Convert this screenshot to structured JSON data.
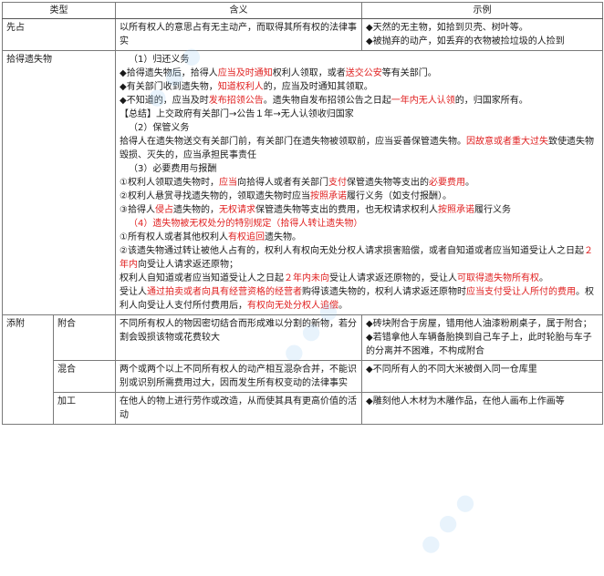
{
  "header": {
    "type": "类型",
    "meaning": "含义",
    "example": "示例"
  },
  "rows": {
    "xianzhan": {
      "type": "先占",
      "meaning": "以所有权人的意思占有无主动产，而取得其所有权的法律事实",
      "examples": [
        "◆天然的无主物，如拾到贝壳、树叶等。",
        "◆被抛弃的动产，如丢弃的衣物被捡垃圾的人捡到"
      ]
    },
    "shide": {
      "type": "拾得遗失物",
      "s1_head": "（1）归还义务",
      "l1_a": "◆拾得遗失物后，拾得人",
      "l1_b": "应当及时通知",
      "l1_c": "权利人领取，或者",
      "l1_d": "送交公安",
      "l1_e": "等有关部门。",
      "l2_a": "◆有关部门收到遗失物，",
      "l2_b": "知道权利人",
      "l2_c": "的，应当及时通知其领取。",
      "l3_a": "◆不知道的，应当及时",
      "l3_b": "发布招领公告",
      "l3_c": "。遗失物自发布招领公告之日起",
      "l3_d": "一年内无人认领",
      "l3_e": "的，归国家所有。",
      "summary": "【总结】上交政府有关部门→公告１年→无人认领收归国家",
      "s2_head": "（2）保管义务",
      "s2_a": "拾得人在遗失物送交有关部门前，有关部门在遗失物被领取前，应当妥善保管遗失物。",
      "s2_b": "因故意或者重大过失",
      "s2_c": "致使遗失物毁损、灭失的，应当承担民事责任",
      "s3_head": "（3）必要费用与报酬",
      "e1_a": "①权利人领取遗失物时，",
      "e1_b": "应当",
      "e1_c": "向拾得人或者有关部门",
      "e1_d": "支付",
      "e1_e": "保管遗失物等支出的",
      "e1_f": "必要费用",
      "e1_g": "。",
      "e2_a": "②权利人悬赏寻找遗失物的，领取遗失物时应当",
      "e2_b": "按照承诺",
      "e2_c": "履行义务（如支付报酬）。",
      "e3_a": "③拾得人",
      "e3_b": "侵占",
      "e3_c": "遗失物的，",
      "e3_d": "无权请求",
      "e3_e": "保管遗失物等支出的费用，也无权请求权利人",
      "e3_f": "按照承诺",
      "e3_g": "履行义务",
      "s4_head": "（4）遗失物被无权处分的特别规定（拾得人转让遗失物）",
      "f1_a": "①所有权人或者其他权利人",
      "f1_b": "有权追回",
      "f1_c": "遗失物。",
      "f2_a": "②该遗失物通过转让被他人占有的，权利人有权向无处分权人请求损害赔偿，或者自知道或者应当知道受让人之日起",
      "f2_b": "２年内",
      "f2_c": "向受让人请求返还原物；",
      "f3_a": "权利人自知道或者应当知道受让人之日起",
      "f3_b": "２年内未向",
      "f3_c": "受让人请求返还原物的，受让人",
      "f3_d": "可取得遗失物所有权",
      "f3_e": "。",
      "f4_a": "受让人",
      "f4_b": "通过拍卖或者向具有经营资格的经营者",
      "f4_c": "购得该遗失物的，权利人请求返还原物时",
      "f4_d": "应当支付受让人所付的费用",
      "f4_e": "。权利人向受让人支付所付费用后，",
      "f4_f": "有权向无处分权人追偿",
      "f4_g": "。"
    },
    "tianfu": {
      "type": "添附",
      "fuhe": {
        "sub": "附合",
        "meaning": "不同所有权人的物因密切结合而形成难以分割的新物，若分割会毁损该物或花费较大",
        "examples": [
          "◆砖块附合于房屋，错用他人油漆粉刷桌子，属于附合；",
          "◆若错拿他人车辆备胎换到自己车子上，此时轮胎与车子的分离并不困难，不构成附合"
        ]
      },
      "hunhe": {
        "sub": "混合",
        "meaning": "两个或两个以上不同所有权人的动产相互混杂合并，不能识别或识别所需费用过大，因而发生所有权变动的法律事实",
        "example": "◆不同所有人的不同大米被倒入同一仓库里"
      },
      "jiagong": {
        "sub": "加工",
        "meaning": "在他人的物上进行劳作或改造，从而使其具有更高价值的活动",
        "example": "◆雕刻他人木材为木雕作品，在他人画布上作画等"
      }
    }
  }
}
